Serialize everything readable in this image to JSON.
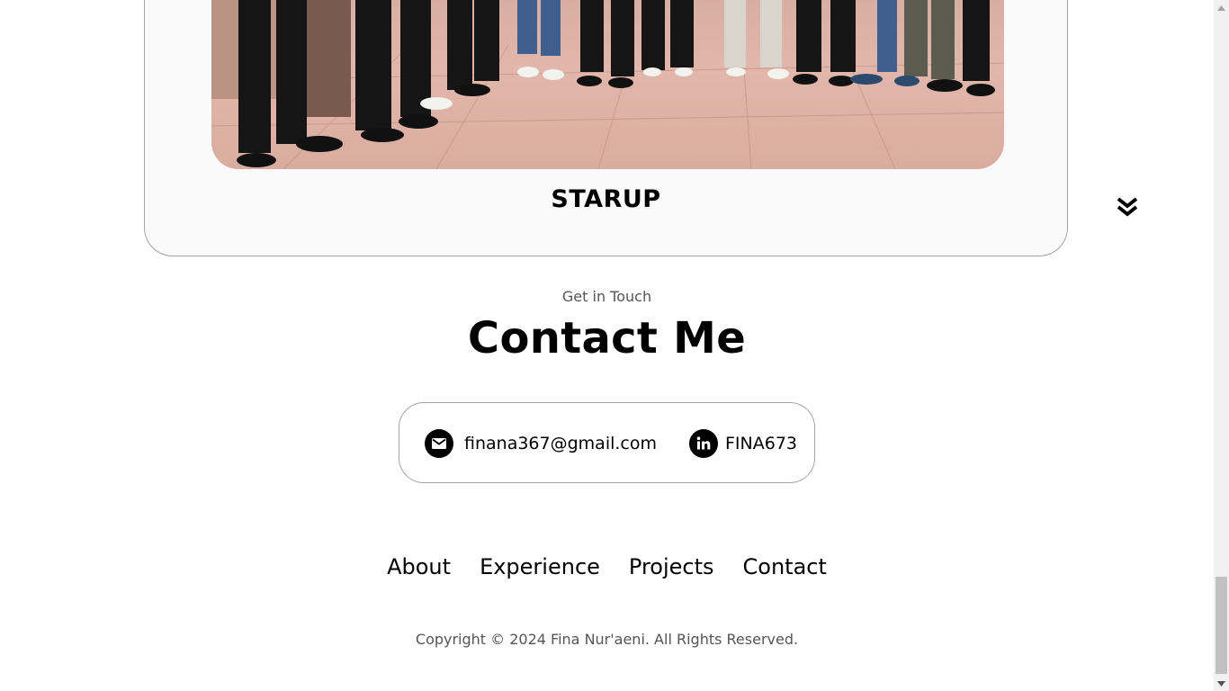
{
  "project": {
    "title": "STARUP",
    "photo_icon": "group-photo",
    "scroll_icon": "double-chevron-down-icon"
  },
  "contact": {
    "eyebrow": "Get in Touch",
    "heading": "Contact Me",
    "email": {
      "icon": "mail-icon",
      "text": "finana367@gmail.com"
    },
    "linkedin": {
      "icon": "linkedin-icon",
      "text": "FINA673"
    }
  },
  "footer": {
    "nav": [
      "About",
      "Experience",
      "Projects",
      "Contact"
    ],
    "copyright": "Copyright © 2024 Fina Nur'aeni. All Rights Reserved."
  },
  "scrollbar": {
    "position_fraction": 0.95
  },
  "colors": {
    "text": "#000000",
    "muted": "#555555",
    "border": "#a3a3a3",
    "card_bg": "#fafafa"
  }
}
